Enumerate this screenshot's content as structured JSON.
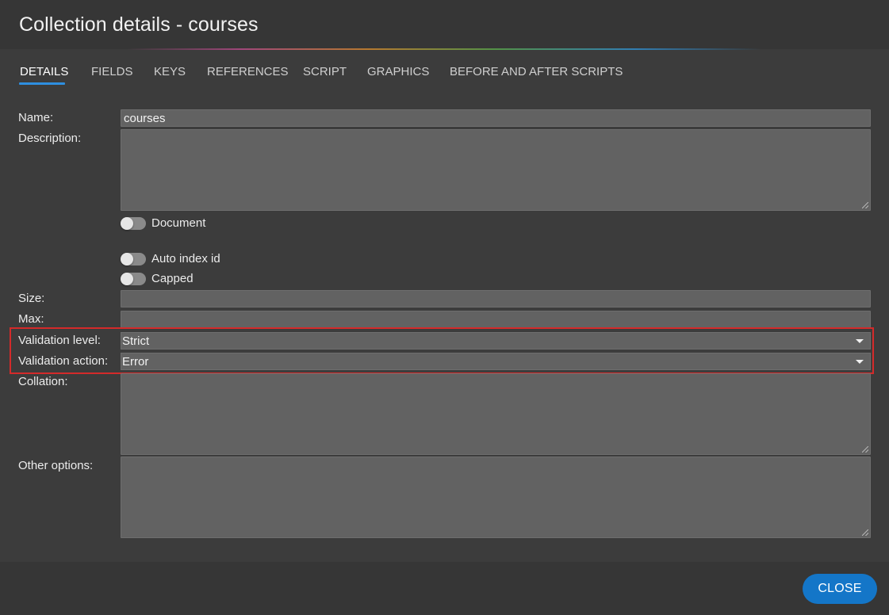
{
  "dialog": {
    "title": "Collection details - courses"
  },
  "tabs": [
    {
      "label": "DETAILS",
      "active": true
    },
    {
      "label": "FIELDS",
      "active": false
    },
    {
      "label": "KEYS",
      "active": false
    },
    {
      "label": "REFERENCES",
      "active": false
    },
    {
      "label": "SCRIPT",
      "active": false
    },
    {
      "label": "GRAPHICS",
      "active": false
    },
    {
      "label": "BEFORE AND AFTER SCRIPTS",
      "active": false
    }
  ],
  "form": {
    "name_label": "Name:",
    "name_value": "courses",
    "description_label": "Description:",
    "description_value": "",
    "document_label": "Document",
    "document_on": false,
    "auto_index_label": "Auto index id",
    "auto_index_on": false,
    "capped_label": "Capped",
    "capped_on": false,
    "size_label": "Size:",
    "size_value": "",
    "max_label": "Max:",
    "max_value": "",
    "validation_level_label": "Validation level:",
    "validation_level_value": "Strict",
    "validation_action_label": "Validation action:",
    "validation_action_value": "Error",
    "collation_label": "Collation:",
    "collation_value": "",
    "other_options_label": "Other options:",
    "other_options_value": ""
  },
  "footer": {
    "close_label": "CLOSE"
  },
  "colors": {
    "accent": "#1476c8",
    "highlight_border": "#d42a2a",
    "background": "#3c3c3c"
  }
}
